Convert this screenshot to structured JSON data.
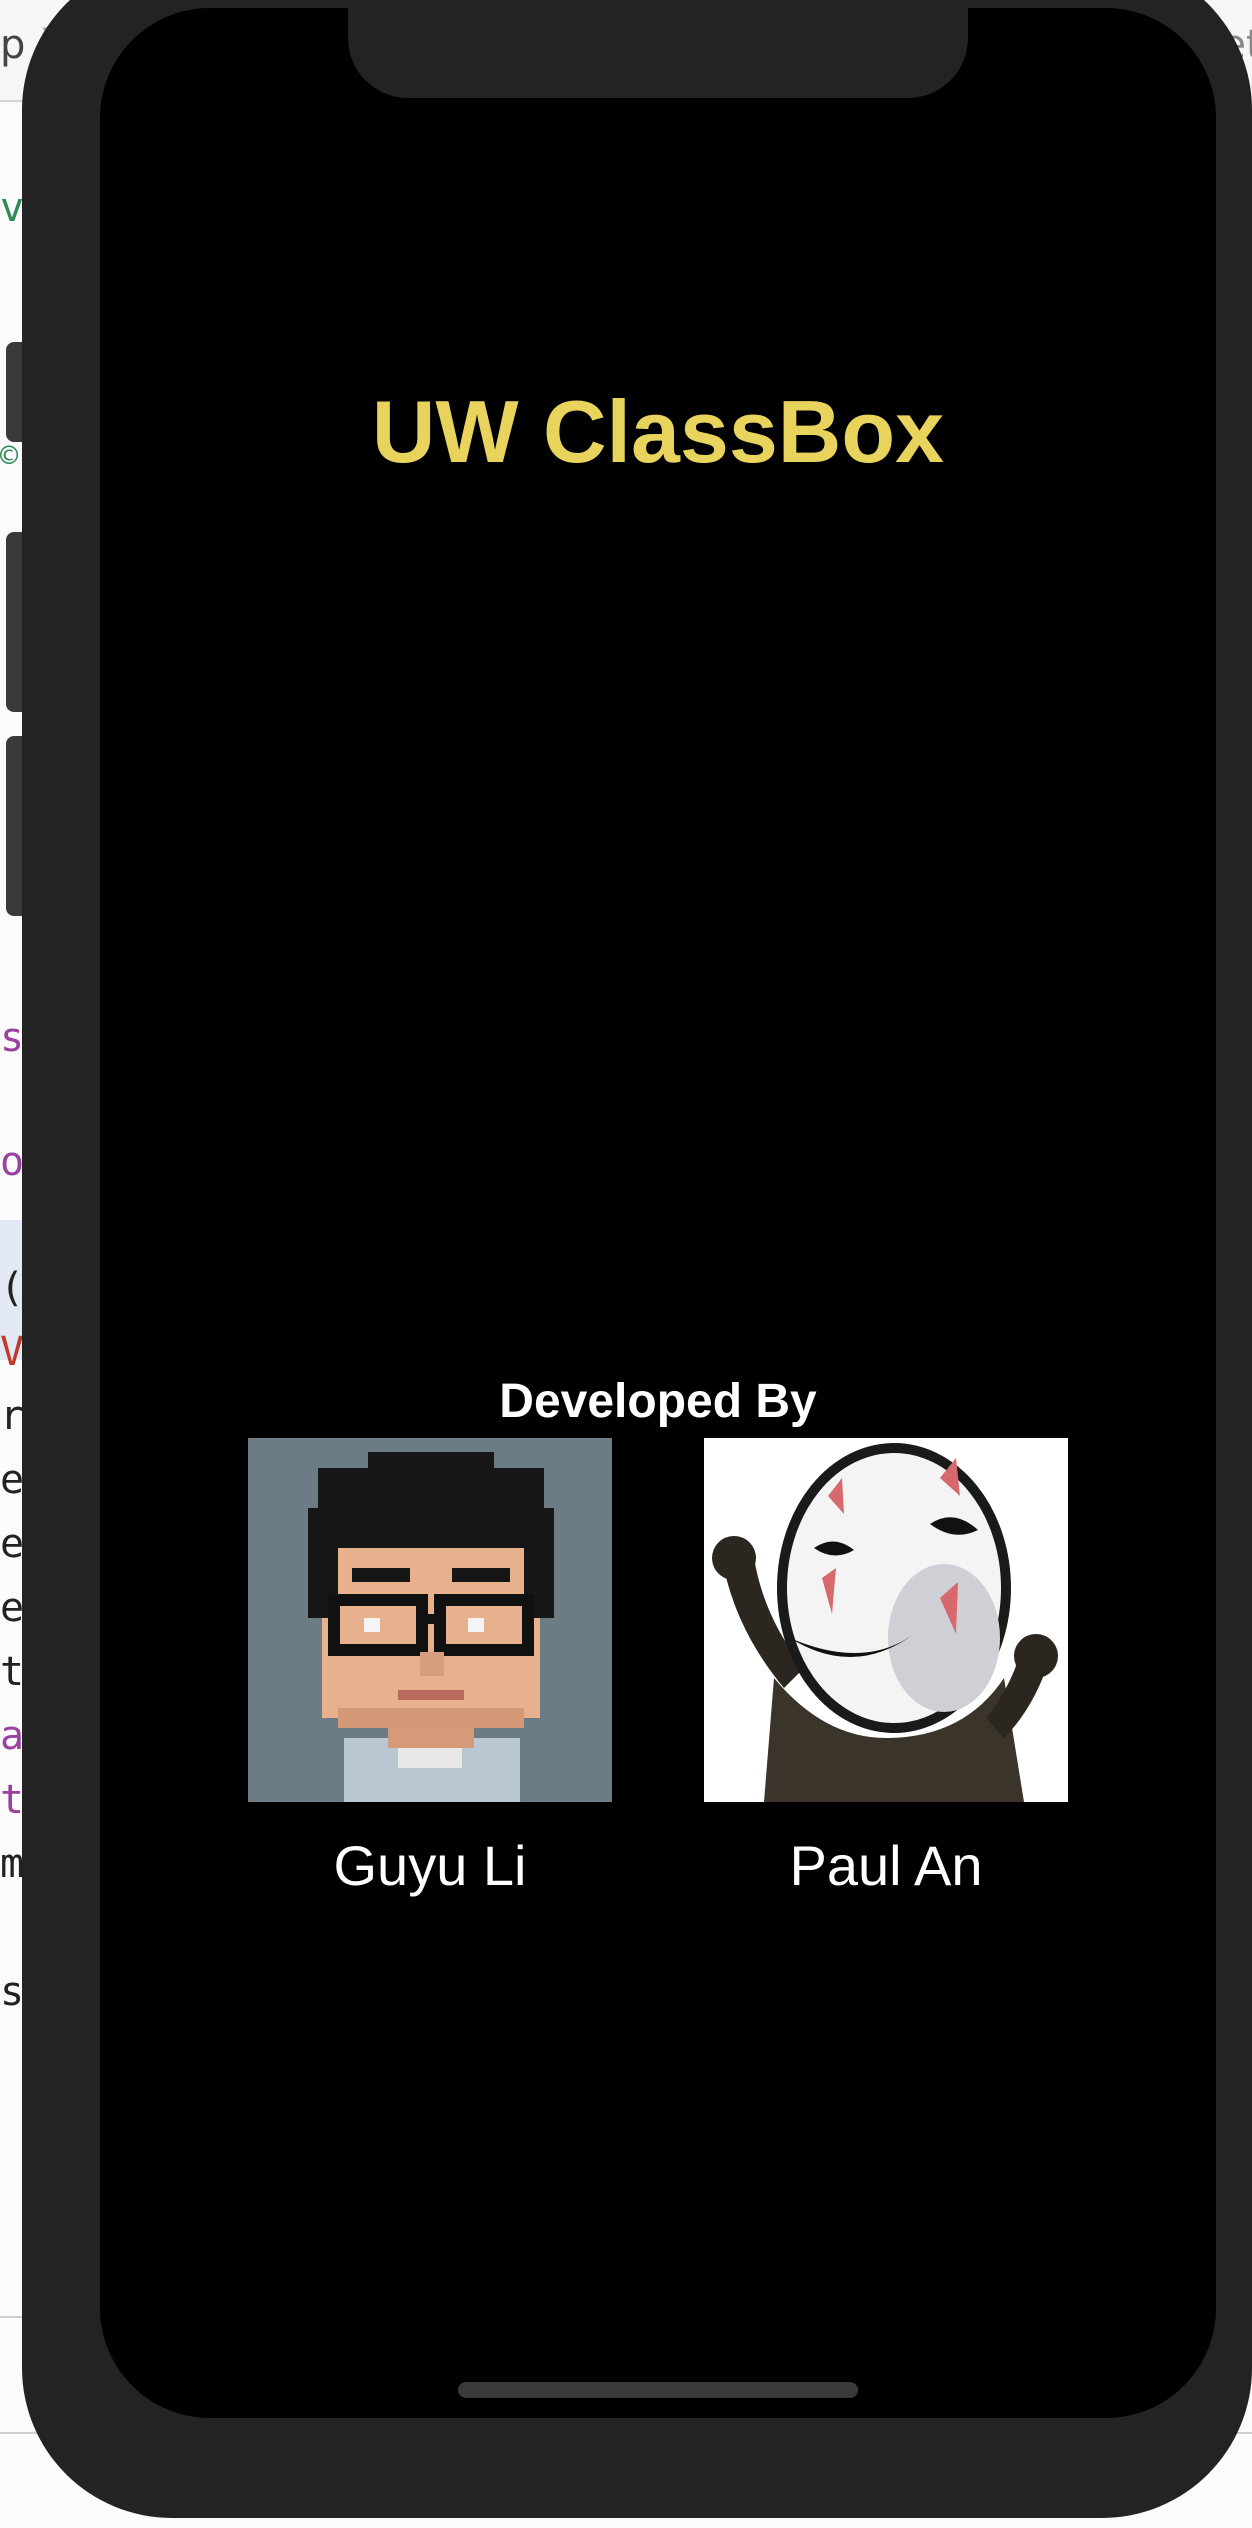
{
  "app": {
    "title": "UW ClassBox",
    "title_color": "#e8d35d",
    "background_color": "#000000"
  },
  "developers": {
    "heading": "Developed By",
    "people": [
      {
        "name": "Guyu Li",
        "avatar_icon": "pixel-art-portrait"
      },
      {
        "name": "Paul An",
        "avatar_icon": "masked-spirit-cartoon"
      }
    ]
  },
  "background_editor": {
    "breadcrumb_left": "p",
    "breadcrumb_right": "get",
    "gutter_glyphs": [
      "vi",
      "©",
      "s",
      "o",
      "(",
      "Va",
      "rl",
      "el",
      "es",
      "el",
      "t",
      "a",
      "t",
      "m",
      "s"
    ]
  }
}
